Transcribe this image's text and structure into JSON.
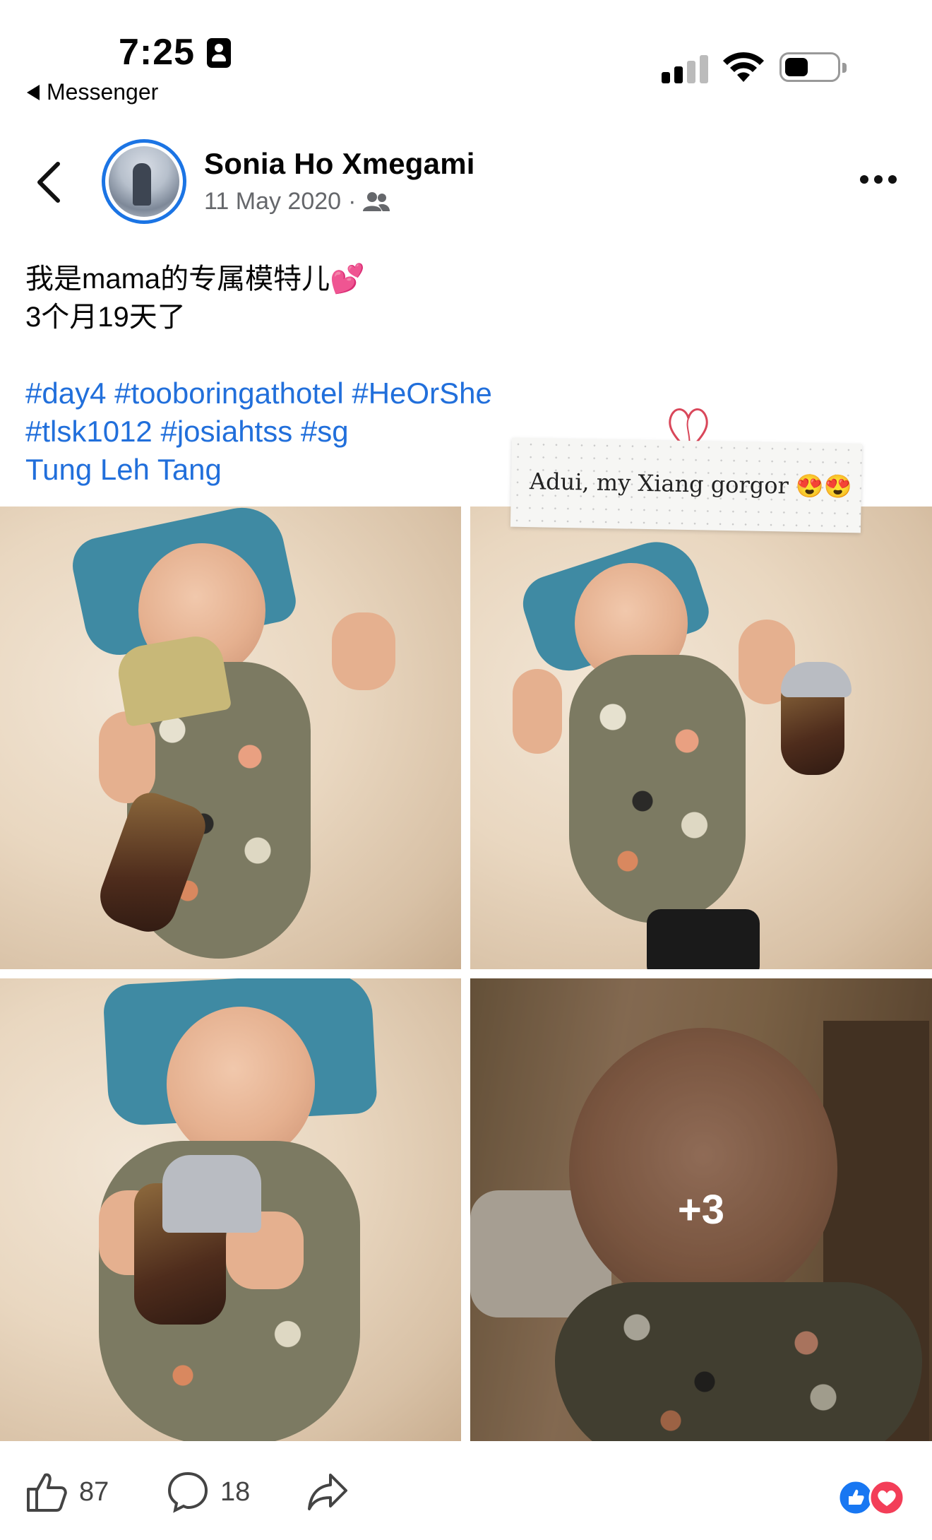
{
  "status_bar": {
    "time": "7:25",
    "back_app": "Messenger"
  },
  "post": {
    "author": "Sonia Ho Xmegami",
    "date": "11 May 2020",
    "audience_icon": "friends-icon",
    "text_lines": [
      "我是mama的专属模特儿💕",
      "3个月19天了"
    ],
    "hashtag_lines": [
      "#day4 #tooboringathotel #HeOrShe",
      "#tlsk1012 #josiahtss #sg",
      "Tung Leh Tang"
    ],
    "sticker_text": "Adui, my Xiang gorgor 😍😍",
    "more_photos": "+3"
  },
  "actions": {
    "like_count": "87",
    "comment_count": "18"
  },
  "colors": {
    "link": "#216fdb",
    "accent": "#1b74e4",
    "like_blue": "#1877f2",
    "love_red": "#f33e58"
  }
}
